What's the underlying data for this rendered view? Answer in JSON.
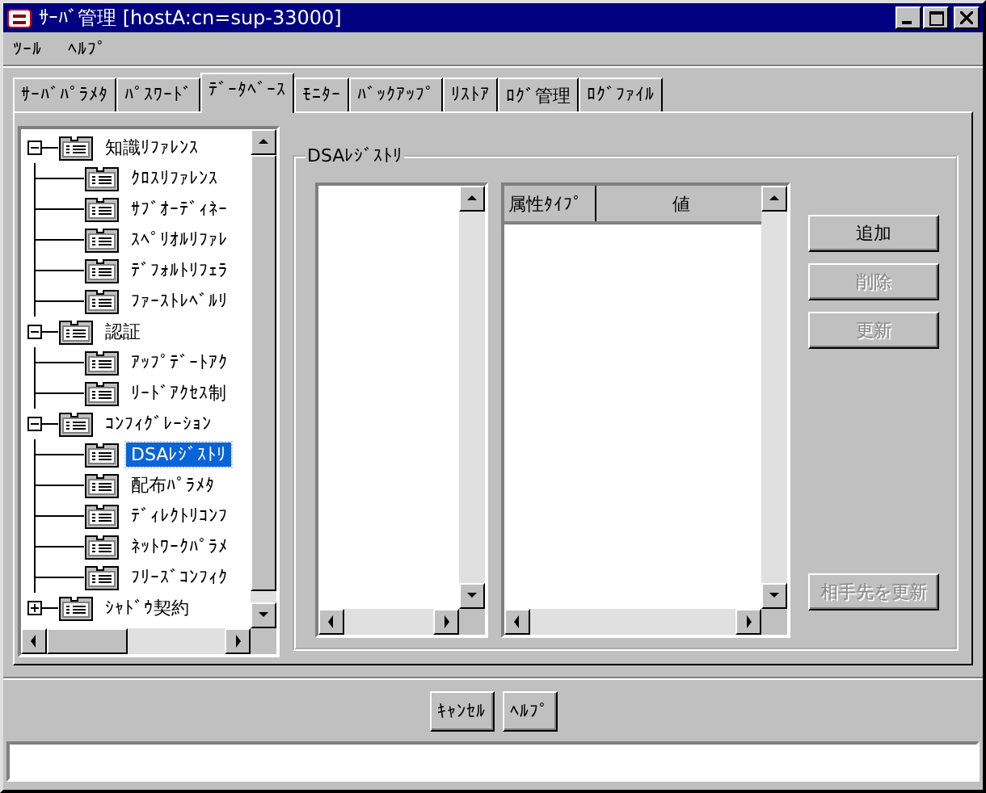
{
  "window": {
    "title": "ｻｰﾊﾞ管理 [hostA:cn=sup-33000]"
  },
  "menu": [
    "ﾂｰﾙ",
    "ﾍﾙﾌﾟ"
  ],
  "tabs": [
    {
      "label": "ｻｰﾊﾞﾊﾟﾗﾒﾀ",
      "selected": false
    },
    {
      "label": "ﾊﾟｽﾜｰﾄﾞ",
      "selected": false
    },
    {
      "label": "ﾃﾞｰﾀﾍﾞｰｽ",
      "selected": true
    },
    {
      "label": "ﾓﾆﾀｰ",
      "selected": false
    },
    {
      "label": "ﾊﾞｯｸｱｯﾌﾟ",
      "selected": false
    },
    {
      "label": "ﾘｽﾄｱ",
      "selected": false
    },
    {
      "label": "ﾛｸﾞ管理",
      "selected": false
    },
    {
      "label": "ﾛｸﾞﾌｧｲﾙ",
      "selected": false
    }
  ],
  "tree": {
    "items": [
      {
        "label": "知識ﾘﾌｧﾚﾝｽ",
        "expanded": true,
        "selected": false,
        "children": [
          {
            "label": "ｸﾛｽﾘﾌｧﾚﾝｽ",
            "selected": false
          },
          {
            "label": "ｻﾌﾞｵｰﾃﾞｨﾈｰ",
            "selected": false
          },
          {
            "label": "ｽﾍﾟﾘｵﾙﾘﾌｧﾚ",
            "selected": false
          },
          {
            "label": "ﾃﾞﾌｫﾙﾄﾘﾌｪﾗ",
            "selected": false
          },
          {
            "label": "ﾌｧｰｽﾄﾚﾍﾞﾙﾘ",
            "selected": false
          }
        ]
      },
      {
        "label": "認証",
        "expanded": true,
        "selected": false,
        "children": [
          {
            "label": "ｱｯﾌﾟﾃﾞｰﾄｱｸ",
            "selected": false
          },
          {
            "label": "ﾘｰﾄﾞｱｸｾｽ制",
            "selected": false
          }
        ]
      },
      {
        "label": "ｺﾝﾌｨｸﾞﾚｰｼｮﾝ",
        "expanded": true,
        "selected": false,
        "children": [
          {
            "label": "DSAﾚｼﾞｽﾄﾘ",
            "selected": true
          },
          {
            "label": "配布ﾊﾟﾗﾒﾀ",
            "selected": false
          },
          {
            "label": "ﾃﾞｨﾚｸﾄﾘｺﾝﾌ",
            "selected": false
          },
          {
            "label": "ﾈｯﾄﾜｰｸﾊﾟﾗﾒ",
            "selected": false
          },
          {
            "label": "ﾌﾘｰｽﾞｺﾝﾌｨｸ",
            "selected": false
          }
        ]
      },
      {
        "label": "ｼｬﾄﾞｳ契約",
        "expanded": false,
        "selected": false
      }
    ]
  },
  "registry": {
    "title": "DSAﾚｼﾞｽﾄﾘ",
    "table": {
      "columns": [
        "属性ﾀｲﾌﾟ",
        "値"
      ]
    },
    "buttons": [
      {
        "label": "追加",
        "disabled": false
      },
      {
        "label": "削除",
        "disabled": true
      },
      {
        "label": "更新",
        "disabled": true
      }
    ],
    "refresh_button": {
      "label": "相手先を更新",
      "disabled": true
    }
  },
  "footer_buttons": [
    "ｷｬﾝｾﾙ",
    "ﾍﾙﾌﾟ"
  ]
}
